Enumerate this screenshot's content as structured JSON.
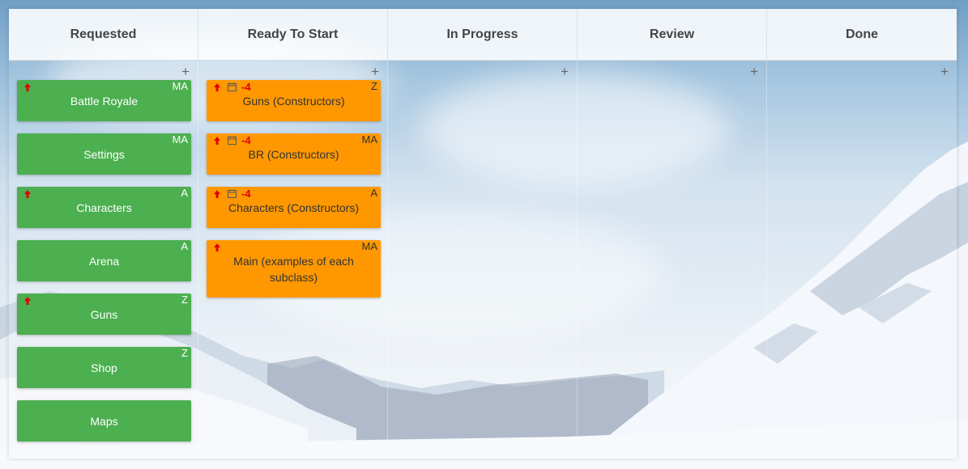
{
  "columns": [
    {
      "title": "Requested",
      "add_label": "+",
      "cards": [
        {
          "title": "Battle Royale",
          "initials": "MA",
          "priority": true,
          "due": "",
          "color": "green"
        },
        {
          "title": "Settings",
          "initials": "MA",
          "priority": false,
          "due": "",
          "color": "green"
        },
        {
          "title": "Characters",
          "initials": "A",
          "priority": true,
          "due": "",
          "color": "green"
        },
        {
          "title": "Arena",
          "initials": "A",
          "priority": false,
          "due": "",
          "color": "green"
        },
        {
          "title": "Guns",
          "initials": "Z",
          "priority": true,
          "due": "",
          "color": "green"
        },
        {
          "title": "Shop",
          "initials": "Z",
          "priority": false,
          "due": "",
          "color": "green"
        },
        {
          "title": "Maps",
          "initials": "",
          "priority": false,
          "due": "",
          "color": "green"
        }
      ]
    },
    {
      "title": "Ready To Start",
      "add_label": "+",
      "cards": [
        {
          "title": "Guns (Constructors)",
          "initials": "Z",
          "priority": true,
          "due": "-4",
          "color": "orange"
        },
        {
          "title": "BR (Constructors)",
          "initials": "MA",
          "priority": true,
          "due": "-4",
          "color": "orange"
        },
        {
          "title": "Characters (Constructors)",
          "initials": "A",
          "priority": true,
          "due": "-4",
          "color": "orange"
        },
        {
          "title": "Main (examples of each subclass)",
          "initials": "MA",
          "priority": true,
          "due": "",
          "color": "orange"
        }
      ]
    },
    {
      "title": "In Progress",
      "add_label": "+",
      "cards": []
    },
    {
      "title": "Review",
      "add_label": "+",
      "cards": []
    },
    {
      "title": "Done",
      "add_label": "+",
      "cards": []
    }
  ],
  "colors": {
    "green_card": "#4caf50",
    "orange_card": "#ff9800",
    "priority_arrow": "#e00000",
    "due_overdue": "#e00000"
  },
  "icons": {
    "priority": "arrow-up-icon",
    "due_date": "calendar-icon",
    "add": "plus-icon"
  }
}
